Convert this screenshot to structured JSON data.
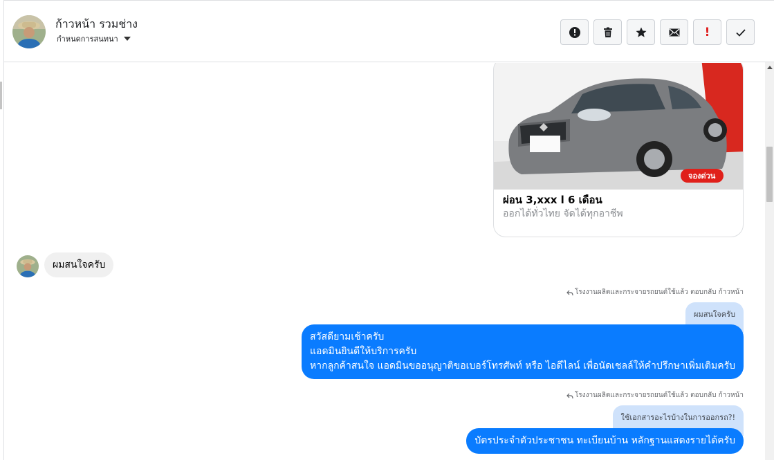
{
  "header": {
    "contact_name": "ก้าวหน้า รวมช่าง",
    "label_button": "กำหนดการสนทนา"
  },
  "toolbar": {
    "buttons": [
      {
        "name": "alert-circle",
        "icon": "alert-circle-icon"
      },
      {
        "name": "trash",
        "icon": "trash-icon"
      },
      {
        "name": "star",
        "icon": "star-icon"
      },
      {
        "name": "mail",
        "icon": "mail-icon"
      },
      {
        "name": "important",
        "icon": "exclamation-icon",
        "glyph": "!"
      },
      {
        "name": "done",
        "icon": "check-icon"
      }
    ]
  },
  "messages": {
    "card": {
      "title": "ผ่อน 3,xxx l 6 เดือน",
      "subtitle": "ออกได้ทั่วไทย จัดได้ทุกอาชีพ",
      "badge": "จองด่วน"
    },
    "incoming_1": "ผมสนใจครับ",
    "reply_meta_1": "โรงงานผลิตและกระจายรถยนต์ใช้แล้ว ตอบกลับ ก้าวหน้า",
    "quote_1": "ผมสนใจครับ",
    "outgoing_1": [
      "สวัสดียามเช้าครับ",
      "แอดมินยินดีให้บริการครับ",
      "หากลูกค้าสนใจ แอดมินขออนุญาติขอเบอร์โทรศัพท์ หรือ ไอดีไลน์ เพื่อนัดเชลล์ให้คำปรึกษาเพิ่มเติมครับ"
    ],
    "reply_meta_2": "โรงงานผลิตและกระจายรถยนต์ใช้แล้ว ตอบกลับ ก้าวหน้า",
    "quote_2": "ใช้เอกสารอะไรบ้างในการออกรถ?!",
    "outgoing_2": "บัตรประจำตัวประชาชน ทะเบียนบ้าน หลักฐานแสดงรายได้ครับ"
  },
  "colors": {
    "outgoing_bubble": "#0a7cff",
    "incoming_bubble": "#f0f0f0",
    "quote_bubble": "#cfe2fb",
    "important_red": "#e02020"
  }
}
